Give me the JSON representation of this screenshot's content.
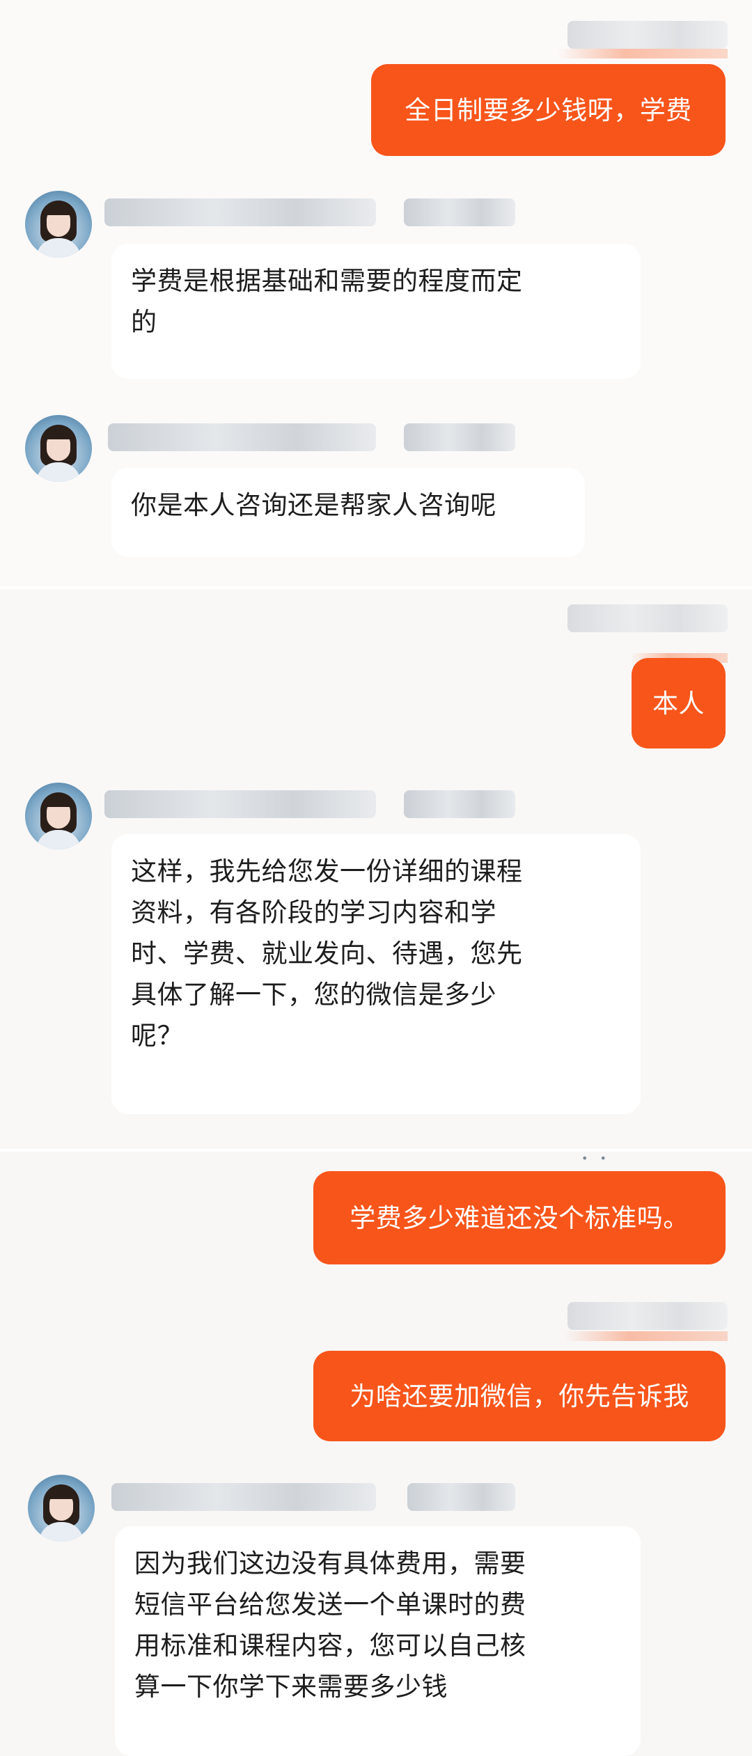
{
  "conversation": {
    "messages": [
      {
        "from": "me",
        "text": "全日制要多少钱呀，学费"
      },
      {
        "from": "them",
        "text": "学费是根据基础和需要的程度而定\n的"
      },
      {
        "from": "them",
        "text": "你是本人咨询还是帮家人咨询呢"
      },
      {
        "from": "me",
        "text": "本人"
      },
      {
        "from": "them",
        "text": "这样，我先给您发一份详细的课程\n资料，有各阶段的学习内容和学\n时、学费、就业发向、待遇，您先\n具体了解一下，您的微信是多少\n呢？"
      },
      {
        "from": "me",
        "text": "学费多少难道还没个标准吗。"
      },
      {
        "from": "me",
        "text": "为啥还要加微信，你先告诉我"
      },
      {
        "from": "them",
        "text": "因为我们这边没有具体费用，需要\n短信平台给您发送一个单课时的费\n用标准和课程内容，您可以自己核\n算一下你学下来需要多少钱"
      }
    ]
  },
  "colors": {
    "page_background": "#f7f6f5",
    "my_bubble": "#f8551b",
    "their_bubble": "#ffffff",
    "their_text": "#1d1d1d"
  },
  "icons": {
    "agent_avatar": "agent-avatar-icon"
  }
}
